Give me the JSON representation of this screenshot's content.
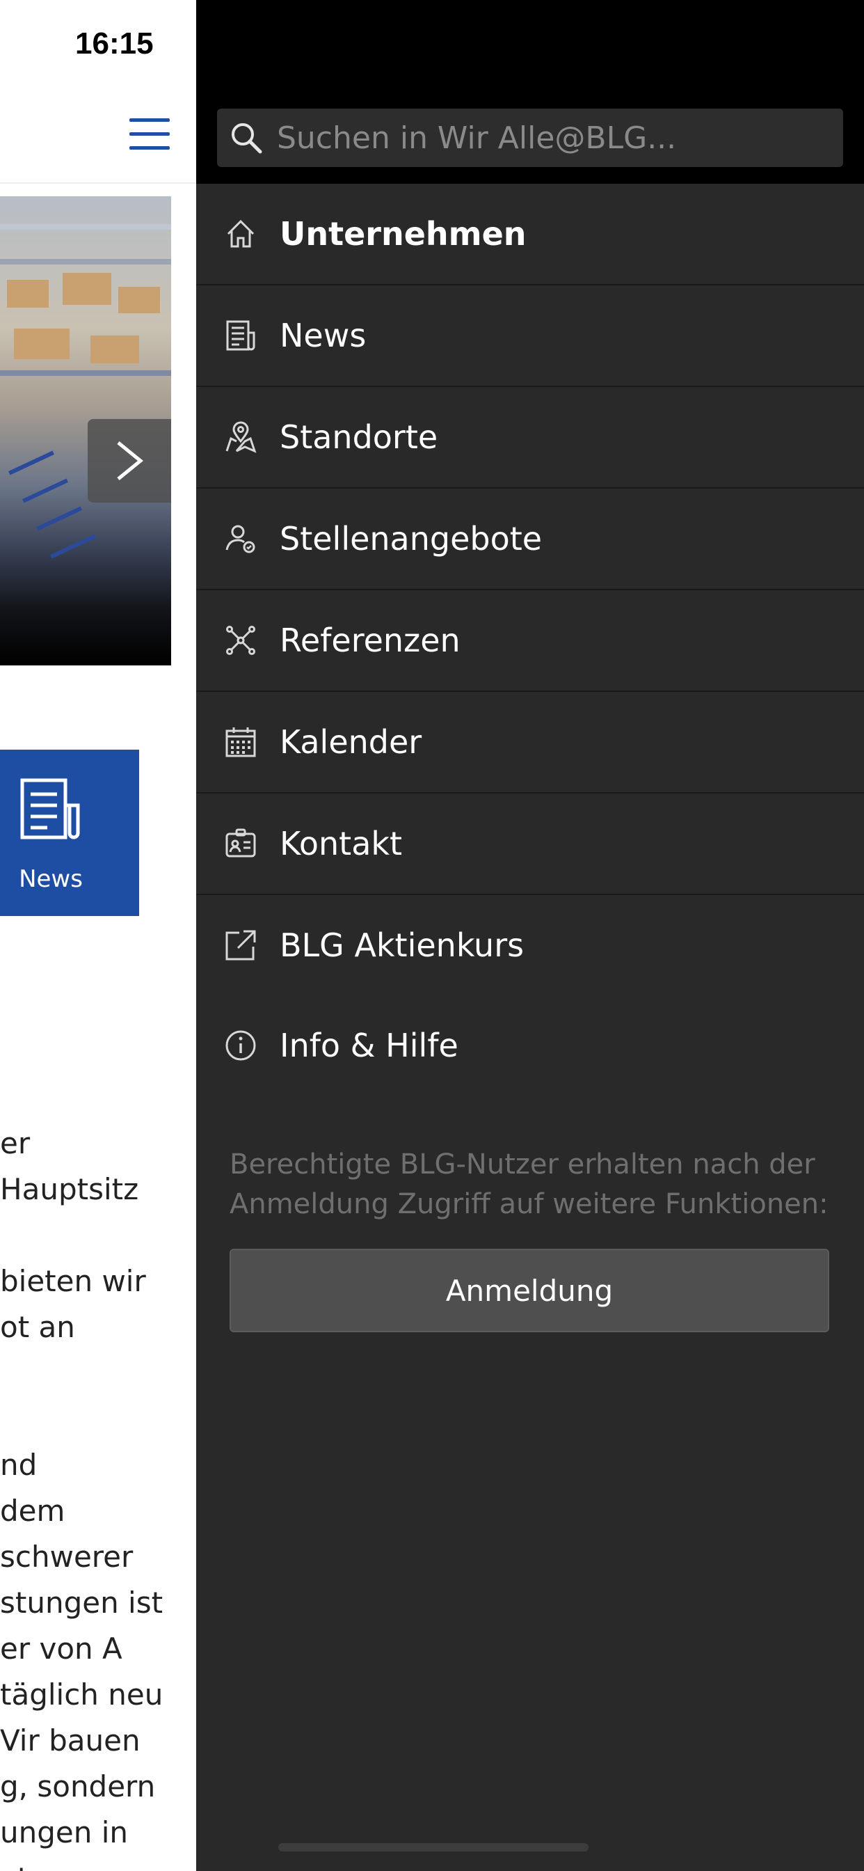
{
  "status_bar": {
    "time": "16:15"
  },
  "background_page": {
    "tile_label": "News",
    "body_lines": [
      "er",
      " Hauptsitz",
      "",
      "bieten wir",
      "ot an",
      "",
      "",
      "nd",
      "dem",
      "schwerer",
      "stungen ist",
      "er von A",
      " täglich neu",
      "Vir bauen",
      "g, sondern",
      "ungen in",
      "xternen"
    ]
  },
  "drawer": {
    "search_placeholder": "Suchen in Wir Alle@BLG...",
    "items": [
      {
        "label": "Unternehmen",
        "icon": "home-icon"
      },
      {
        "label": "News",
        "icon": "newspaper-icon"
      },
      {
        "label": "Standorte",
        "icon": "map-pin-icon"
      },
      {
        "label": "Stellenangebote",
        "icon": "jobs-icon"
      },
      {
        "label": "Referenzen",
        "icon": "network-icon"
      },
      {
        "label": "Kalender",
        "icon": "calendar-icon"
      },
      {
        "label": "Kontakt",
        "icon": "contact-card-icon"
      },
      {
        "label": "BLG Aktienkurs",
        "icon": "external-link-icon"
      },
      {
        "label": "Info & Hilfe",
        "icon": "info-icon"
      }
    ],
    "login_hint": "Berechtigte BLG-Nutzer erhalten nach der Anmeldung Zugriff auf weitere Funktionen:",
    "login_button": "Anmeldung"
  },
  "colors": {
    "accent": "#1e4ea3",
    "drawer_bg": "#292929",
    "drawer_header_bg": "#000000"
  }
}
